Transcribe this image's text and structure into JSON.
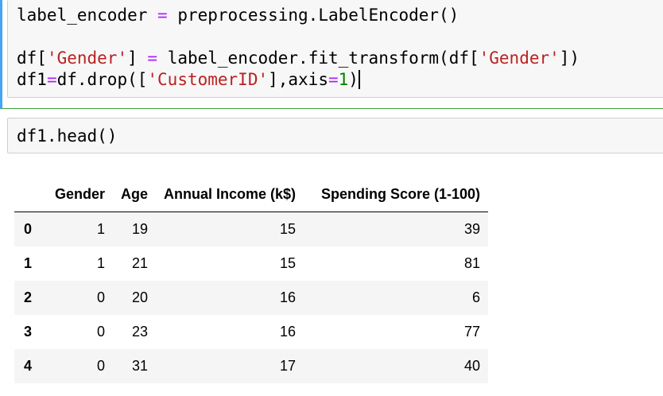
{
  "cell1": {
    "lines": [
      [
        {
          "t": "label_encoder ",
          "c": ""
        },
        {
          "t": "=",
          "c": "op"
        },
        {
          "t": " preprocessing.LabelEncoder()",
          "c": ""
        }
      ],
      [],
      [
        {
          "t": "df[",
          "c": ""
        },
        {
          "t": "'Gender'",
          "c": "str"
        },
        {
          "t": "] ",
          "c": ""
        },
        {
          "t": "=",
          "c": "op"
        },
        {
          "t": " label_encoder.fit_transform(df[",
          "c": ""
        },
        {
          "t": "'Gender'",
          "c": "str"
        },
        {
          "t": "])",
          "c": ""
        }
      ],
      [
        {
          "t": "df1",
          "c": ""
        },
        {
          "t": "=",
          "c": "op"
        },
        {
          "t": "df.drop([",
          "c": ""
        },
        {
          "t": "'CustomerID'",
          "c": "str"
        },
        {
          "t": "],axis",
          "c": ""
        },
        {
          "t": "=",
          "c": "op"
        },
        {
          "t": "1",
          "c": "num"
        },
        {
          "t": ")",
          "c": ""
        }
      ]
    ]
  },
  "cell2": {
    "code": "df1.head()"
  },
  "table": {
    "columns": [
      "",
      "Gender",
      "Age",
      "Annual Income (k$)",
      "Spending Score (1-100)"
    ],
    "rows": [
      {
        "index": "0",
        "gender": "1",
        "age": "19",
        "income": "15",
        "score": "39"
      },
      {
        "index": "1",
        "gender": "1",
        "age": "21",
        "income": "15",
        "score": "81"
      },
      {
        "index": "2",
        "gender": "0",
        "age": "20",
        "income": "16",
        "score": "6"
      },
      {
        "index": "3",
        "gender": "0",
        "age": "23",
        "income": "16",
        "score": "77"
      },
      {
        "index": "4",
        "gender": "0",
        "age": "31",
        "income": "17",
        "score": "40"
      }
    ]
  },
  "colors": {
    "operator": "#aa22ff",
    "string": "#ba2121",
    "number": "#008000",
    "selected_cell_border": "#42a5f5",
    "input_background": "#f7f7f7"
  }
}
